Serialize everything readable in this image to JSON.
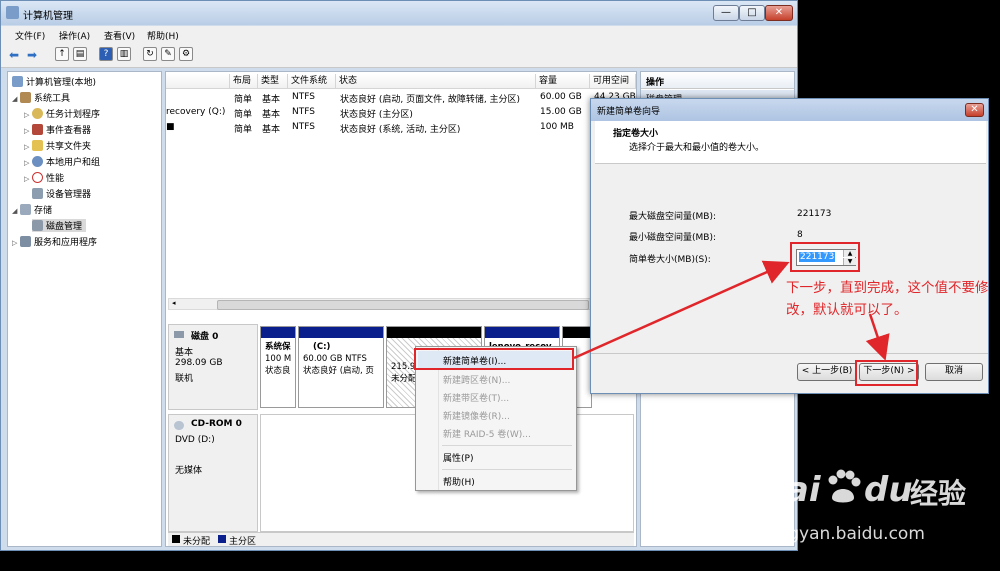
{
  "window": {
    "title": "计算机管理",
    "controls": [
      "—",
      "□",
      "✕"
    ]
  },
  "menu": [
    "文件(F)",
    "操作(A)",
    "查看(V)",
    "帮助(H)"
  ],
  "tree": {
    "root": "计算机管理(本地)",
    "system_tools": "系统工具",
    "task_scheduler": "任务计划程序",
    "event_viewer": "事件查看器",
    "shared_folders": "共享文件夹",
    "local_users": "本地用户和组",
    "performance": "性能",
    "device_manager": "设备管理器",
    "storage": "存储",
    "disk_management": "磁盘管理",
    "services_apps": "服务和应用程序"
  },
  "volumes": {
    "headers": [
      "布局",
      "类型",
      "文件系统",
      "状态",
      "容量",
      "可用空间"
    ],
    "rows": [
      [
        "",
        "简单",
        "基本",
        "NTFS",
        "状态良好 (启动, 页面文件, 故障转储, 主分区)",
        "60.00 GB",
        "44.23 GB"
      ],
      [
        "recovery (Q:)",
        "简单",
        "基本",
        "NTFS",
        "状态良好 (主分区)",
        "15.00 GB",
        ""
      ],
      [
        "■",
        "简单",
        "基本",
        "NTFS",
        "状态良好 (系统, 活动, 主分区)",
        "100 MB",
        ""
      ]
    ]
  },
  "disk0": {
    "name": "磁盘 0",
    "type": "基本",
    "size": "298.09 GB",
    "status": "联机"
  },
  "partitions": {
    "p1": {
      "l1": "系统保",
      "l2": "100 M",
      "l3": "状态良"
    },
    "p2": {
      "l1": "(C:)",
      "l2": "60.00 GB NTFS",
      "l3": "状态良好 (启动, 页"
    },
    "p3": {
      "l1": "215.9",
      "l2": "未分配"
    },
    "p4": {
      "l1": "lenovo_recov"
    }
  },
  "cdrom": {
    "name": "CD-ROM 0",
    "drive": "DVD (D:)",
    "media": "无媒体"
  },
  "legend": {
    "unallocated": "未分配",
    "primary": "主分区"
  },
  "actions": {
    "header": "操作",
    "item": "磁盘管理"
  },
  "context_menu": {
    "new_simple": "新建简单卷(I)...",
    "new_spanned": "新建跨区卷(N)...",
    "new_striped": "新建带区卷(T)...",
    "new_mirror": "新建镜像卷(R)...",
    "new_raid5": "新建 RAID-5 卷(W)...",
    "properties": "属性(P)",
    "help": "帮助(H)"
  },
  "wizard": {
    "title": "新建简单卷向导",
    "close": "✕",
    "heading": "指定卷大小",
    "subheading": "选择介于最大和最小值的卷大小。",
    "max_label": "最大磁盘空间量(MB):",
    "max_value": "221173",
    "min_label": "最小磁盘空间量(MB):",
    "min_value": "8",
    "size_label": "简单卷大小(MB)(S):",
    "size_value": "221173",
    "back": "< 上一步(B)",
    "next": "下一步(N) >",
    "cancel": "取消"
  },
  "annotation": "下一步，直到完成，这个值不要修改，默认就可以了。",
  "watermark": {
    "brand": "Bai",
    "brand2": "du",
    "brand_cn": "经验",
    "url": "jingyan.baidu.com"
  },
  "colors": {
    "primary_partition": "#0b1f8c",
    "unallocated": "#000000",
    "annotation": "#e0262a",
    "accent": "#3399ff"
  }
}
